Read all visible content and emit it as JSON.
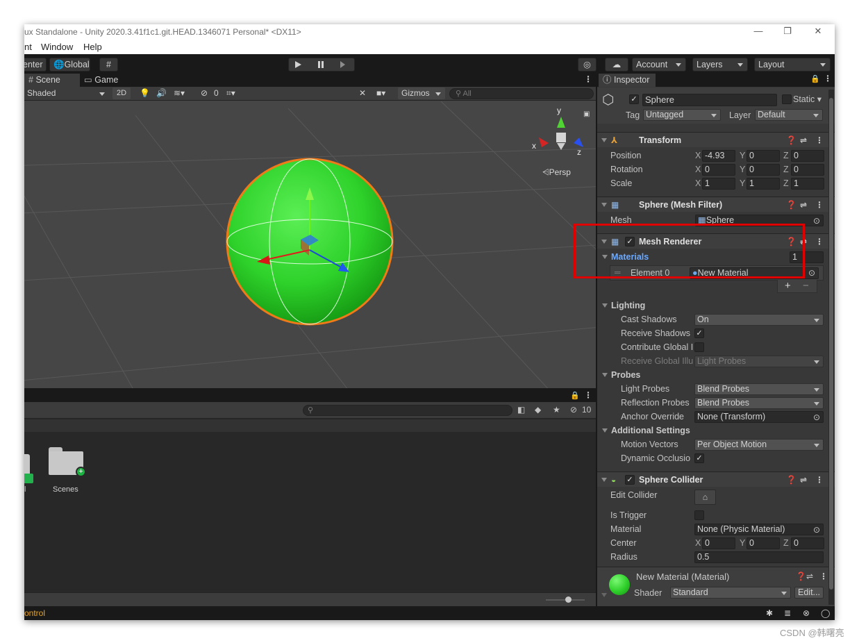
{
  "window": {
    "title": "ux Standalone - Unity 2020.3.41f1c1.git.HEAD.1346071 Personal* <DX11>",
    "minimize": "—",
    "restore": "❐",
    "close": "✕"
  },
  "menu": {
    "items": [
      "nt",
      "Window",
      "Help"
    ]
  },
  "toolbar": {
    "pivot_label": "enter",
    "global_label": "Global",
    "account": "Account",
    "layers": "Layers",
    "layout": "Layout"
  },
  "scene": {
    "tab_scene": "Scene",
    "tab_game": "Game",
    "shading": "Shaded",
    "mode_2d": "2D",
    "hidden_count": "0",
    "gizmos": "Gizmos",
    "search_placeholder": "All",
    "axis_y": "y",
    "axis_x": "x",
    "axis_z": "z",
    "persp": "Persp"
  },
  "project": {
    "hidden_count": "10",
    "folder_name": "Scenes",
    "partial_label": "l"
  },
  "status": {
    "text": "ontrol"
  },
  "inspector": {
    "tab": "Inspector",
    "object_name": "Sphere",
    "static": "Static",
    "tag_label": "Tag",
    "tag": "Untagged",
    "layer_label": "Layer",
    "layer": "Default",
    "transform": {
      "title": "Transform",
      "position": "Position",
      "rotation": "Rotation",
      "scale": "Scale",
      "pos": [
        "-4.93",
        "0",
        "0"
      ],
      "rot": [
        "0",
        "0",
        "0"
      ],
      "scl": [
        "1",
        "1",
        "1"
      ]
    },
    "mesh_filter": {
      "title": "Sphere (Mesh Filter)",
      "mesh_label": "Mesh",
      "mesh": "Sphere"
    },
    "mesh_renderer": {
      "title": "Mesh Renderer",
      "materials": "Materials",
      "count": "1",
      "element": "Element 0",
      "material": "New Material",
      "lighting": "Lighting",
      "cast_shadows": "Cast Shadows",
      "cast_value": "On",
      "receive_shadows": "Receive Shadows",
      "contribute_gi": "Contribute Global I",
      "receive_gi": "Receive Global Illu",
      "receive_gi_value": "Light Probes",
      "probes": "Probes",
      "light_probes": "Light Probes",
      "light_probes_value": "Blend Probes",
      "reflection_probes": "Reflection Probes",
      "reflection_value": "Blend Probes",
      "anchor": "Anchor Override",
      "anchor_value": "None (Transform)",
      "additional": "Additional Settings",
      "motion_vectors": "Motion Vectors",
      "motion_value": "Per Object Motion",
      "dynamic_occlusion": "Dynamic Occlusio"
    },
    "sphere_collider": {
      "title": "Sphere Collider",
      "edit_collider": "Edit Collider",
      "is_trigger": "Is Trigger",
      "material_label": "Material",
      "material": "None (Physic Material)",
      "center": "Center",
      "center_vals": [
        "0",
        "0",
        "0"
      ],
      "radius": "Radius",
      "radius_value": "0.5"
    },
    "material_preview": {
      "title": "New Material (Material)",
      "shader_label": "Shader",
      "shader": "Standard",
      "edit": "Edit..."
    }
  },
  "watermark": "CSDN @韩曙亮",
  "colors": {
    "sphere": "#32d62e",
    "highlight": "#e10000",
    "selection_outline": "#f07a18",
    "link_blue": "#6ba9ff"
  }
}
